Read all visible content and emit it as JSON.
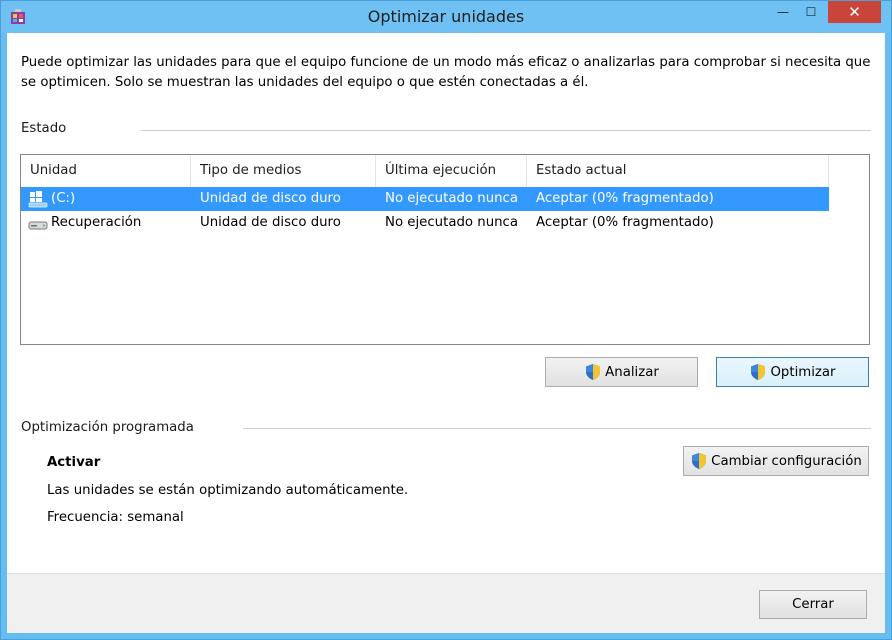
{
  "window": {
    "title": "Optimizar unidades",
    "controls": {
      "minimize": "—",
      "maximize": "☐",
      "close": "✕"
    }
  },
  "intro_text": "Puede optimizar las unidades para que el equipo funcione de un modo más eficaz o analizarlas para comprobar si necesita que se optimicen. Solo se muestran las unidades del equipo o que estén conectadas a él.",
  "status_section": {
    "label": "Estado",
    "columns": [
      "Unidad",
      "Tipo de medios",
      "Última ejecución",
      "Estado actual"
    ],
    "rows": [
      {
        "drive": "(C:)",
        "media": "Unidad de disco duro",
        "last_run": "No ejecutado nunca",
        "status": "Aceptar (0% fragmentado)",
        "icon": "windows-drive-icon",
        "selected": true
      },
      {
        "drive": "Recuperación",
        "media": "Unidad de disco duro",
        "last_run": "No ejecutado nunca",
        "status": "Aceptar (0% fragmentado)",
        "icon": "disk-drive-icon",
        "selected": false
      }
    ]
  },
  "buttons": {
    "analyze": "Analizar",
    "optimize": "Optimizar",
    "change_settings": "Cambiar configuración",
    "close": "Cerrar"
  },
  "scheduled_section": {
    "label": "Optimización programada",
    "state": "Activar",
    "description": "Las unidades se están optimizando automáticamente.",
    "frequency": "Frecuencia: semanal"
  },
  "colors": {
    "title_bar": "#6ec1f2",
    "selection": "#3399ff",
    "close_button": "#c9453a"
  }
}
